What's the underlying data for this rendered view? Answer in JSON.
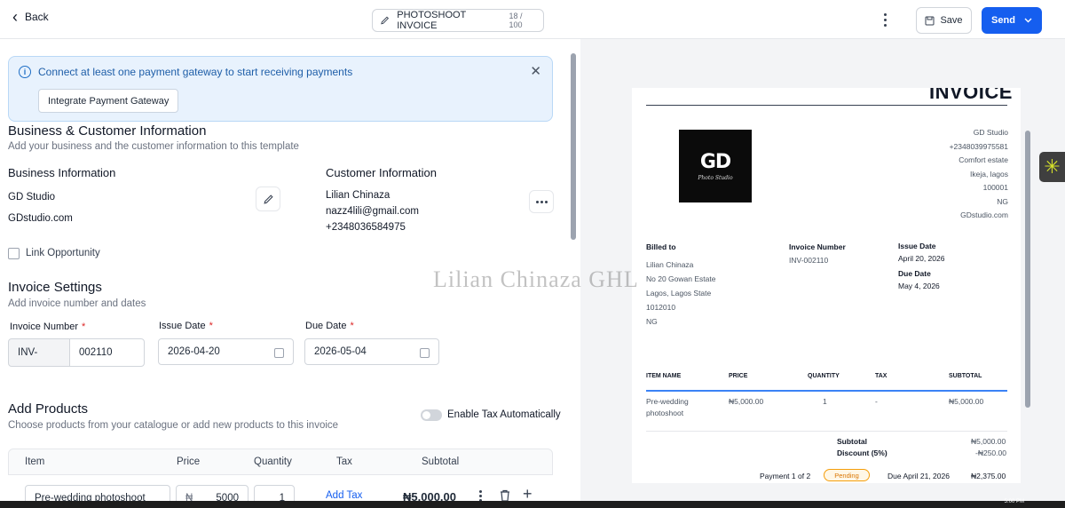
{
  "header": {
    "back_label": "Back",
    "doc_title": "PHOTOSHOOT INVOICE",
    "title_counter": "18 / 100",
    "save_label": "Save",
    "send_label": "Send"
  },
  "banner": {
    "message": "Connect at least one payment gateway to start receiving payments",
    "button_label": "Integrate Payment Gateway"
  },
  "business_customer": {
    "heading": "Business & Customer Information",
    "subheading": "Add your business and the customer information to this template",
    "business": {
      "heading": "Business Information",
      "name": "GD Studio",
      "website": "GDstudio.com"
    },
    "customer": {
      "heading": "Customer Information",
      "name": "Lilian Chinaza",
      "email": "nazz4lili@gmail.com",
      "phone": "+2348036584975"
    },
    "link_opportunity_label": "Link Opportunity"
  },
  "invoice_settings": {
    "heading": "Invoice Settings",
    "subheading": "Add invoice number and dates",
    "number_label": "Invoice Number",
    "number_prefix": "INV-",
    "number_value": "002110",
    "issue_label": "Issue Date",
    "issue_value": "2026-04-20",
    "due_label": "Due Date",
    "due_value": "2026-05-04",
    "required_mark": "*"
  },
  "products": {
    "heading": "Add Products",
    "subheading": "Choose products from your catalogue or add new products to this invoice",
    "tax_toggle_label": "Enable Tax Automatically",
    "columns": [
      "Item",
      "Price",
      "Quantity",
      "Tax",
      "Subtotal"
    ],
    "row": {
      "item": "Pre-wedding photoshoot",
      "currency": "₦",
      "price": "5000",
      "quantity": "1",
      "add_tax_label": "Add Tax",
      "subtotal": "₦5,000.00"
    }
  },
  "preview": {
    "title": "INVOICE",
    "business_lines": [
      "GD Studio",
      "+2348039975581",
      "Comfort estate",
      "Ikeja, lagos",
      "100001",
      "NG",
      "GDstudio.com"
    ],
    "logo_text": "GD",
    "billed_to_label": "Billed to",
    "billed_lines": [
      "Lilian Chinaza",
      "No 20 Gowan Estate",
      "Lagos, Lagos State",
      "1012010",
      "NG"
    ],
    "invoice_number_label": "Invoice Number",
    "invoice_number": "INV-002110",
    "issue_date_label": "Issue Date",
    "issue_date": "April 20, 2026",
    "due_date_label": "Due Date",
    "due_date": "May 4, 2026",
    "columns": [
      "ITEM NAME",
      "PRICE",
      "QUANTITY",
      "TAX",
      "SUBTOTAL"
    ],
    "item_name_line1": "Pre-wedding",
    "item_name_line2": "photoshoot",
    "item_price": "₦5,000.00",
    "item_qty": "1",
    "item_tax": "-",
    "item_subtotal": "₦5,000.00",
    "subtotal_label": "Subtotal",
    "subtotal_value": "₦5,000.00",
    "discount_label": "Discount (5%)",
    "discount_value": "-₦250.00",
    "payment_label": "Payment 1 of 2",
    "status": "Pending",
    "due_line": "Due April 21, 2026",
    "payment_amount": "₦2,375.00"
  },
  "watermark": "Lilian Chinaza GHL",
  "taskbar": {
    "clock": "5:00 PM"
  },
  "colors": {
    "primary": "#155eef",
    "banner_bg": "#e8f2fd",
    "pending": "#d97706"
  }
}
